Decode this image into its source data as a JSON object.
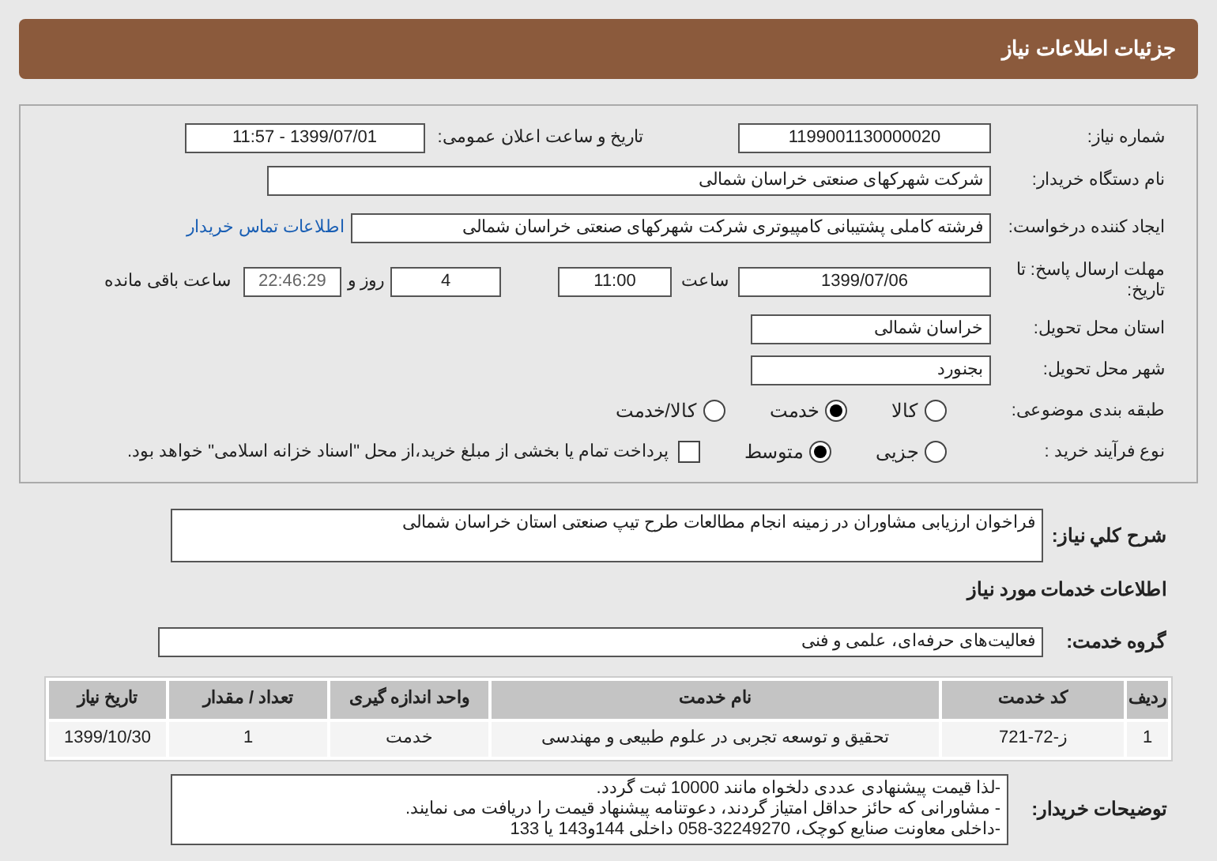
{
  "header": {
    "title": "جزئیات اطلاعات نیاز"
  },
  "need": {
    "number_label": "شماره نیاز:",
    "number": "1199001130000020",
    "announce_label": "تاریخ و ساعت اعلان عمومی:",
    "announce": "1399/07/01 - 11:57",
    "buyer_label": "نام دستگاه خریدار:",
    "buyer": "شرکت شهرکهای صنعتی خراسان شمالی",
    "creator_label": "ایجاد کننده درخواست:",
    "creator": "فرشته کاملی پشتیبانی کامپیوتری شرکت شهرکهای صنعتی خراسان شمالی",
    "contact_link": "اطلاعات تماس خریدار",
    "deadline_label": "مهلت ارسال پاسخ: تا تاریخ:",
    "deadline_date": "1399/07/06",
    "time_label": "ساعت",
    "deadline_time": "11:00",
    "days": "4",
    "days_label": "روز و",
    "remaining": "22:46:29",
    "remaining_label": "ساعت باقی مانده",
    "province_label": "استان محل تحویل:",
    "province": "خراسان شمالی",
    "city_label": "شهر محل تحویل:",
    "city": "بجنورد",
    "category_label": "طبقه بندی موضوعی:",
    "category_options": [
      {
        "label": "کالا",
        "selected": false
      },
      {
        "label": "خدمت",
        "selected": true
      },
      {
        "label": "کالا/خدمت",
        "selected": false
      }
    ],
    "process_label": "نوع فرآیند خرید :",
    "process_options": [
      {
        "label": "جزیی",
        "selected": false
      },
      {
        "label": "متوسط",
        "selected": true
      }
    ],
    "payment": {
      "label": "پرداخت تمام یا بخشی از مبلغ خرید،از محل \"اسناد خزانه اسلامی\" خواهد بود.",
      "checked": false
    }
  },
  "description": {
    "label": "شرح کلي نياز:",
    "text": "فراخوان ارزیابی مشاوران در زمینه انجام مطالعات طرح تیپ صنعتی استان خراسان شمالی"
  },
  "services": {
    "title": "اطلاعات خدمات مورد نیاز",
    "group_label": "گروه خدمت:",
    "group": "فعالیت‌های حرفه‌ای، علمی و فنی",
    "table": {
      "columns": [
        "ردیف",
        "کد خدمت",
        "نام خدمت",
        "واحد اندازه گیری",
        "تعداد / مقدار",
        "تاریخ نیاز"
      ],
      "rows": [
        [
          "1",
          "ز-72-721",
          "تحقیق و توسعه تجربی در علوم طبیعی و مهندسی",
          "خدمت",
          "1",
          "1399/10/30"
        ]
      ]
    }
  },
  "notes": {
    "label": "توضیحات خریدار:",
    "lines": [
      "-لذا قیمت پیشنهادی عددی دلخواه مانند 10000 ثبت گردد.",
      "- مشاورانی که حائز حداقل امتیاز گردند، دعوتنامه پیشنهاد قیمت را دریافت می نمایند.",
      "-داخلی معاونت صنایع کوچک، 32249270-058 داخلی 144و143 یا 133"
    ]
  }
}
